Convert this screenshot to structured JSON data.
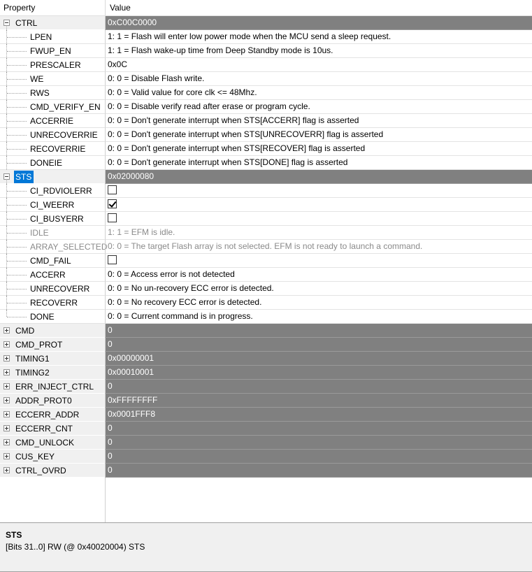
{
  "header": {
    "property": "Property",
    "value": "Value"
  },
  "rows": [
    {
      "name": "CTRL",
      "value": "0xC00C0000",
      "level": "top",
      "expander": "minus",
      "dark": true
    },
    {
      "name": "LPEN",
      "value": "1: 1 = Flash will enter low power mode when the MCU send a sleep request.",
      "level": "child"
    },
    {
      "name": "FWUP_EN",
      "value": "1: 1 = Flash wake-up time from Deep Standby mode is 10us.",
      "level": "child"
    },
    {
      "name": "PRESCALER",
      "value": "0x0C",
      "level": "child"
    },
    {
      "name": "WE",
      "value": "0: 0 = Disable Flash write.",
      "level": "child"
    },
    {
      "name": "RWS",
      "value": "0: 0 = Valid value for core clk <= 48Mhz.",
      "level": "child"
    },
    {
      "name": "CMD_VERIFY_EN",
      "value": "0: 0 = Disable verify read after erase or program cycle.",
      "level": "child"
    },
    {
      "name": "ACCERRIE",
      "value": "0: 0 = Don't generate interrupt when STS[ACCERR] flag is asserted",
      "level": "child"
    },
    {
      "name": "UNRECOVERRIE",
      "value": "0: 0 = Don't generate interrupt when STS[UNRECOVERR] flag is asserted",
      "level": "child"
    },
    {
      "name": "RECOVERRIE",
      "value": "0: 0 = Don't generate interrupt when STS[RECOVER] flag is asserted",
      "level": "child"
    },
    {
      "name": "DONEIE",
      "value": "0: 0 = Don't generate interrupt when STS[DONE] flag is asserted",
      "level": "child"
    },
    {
      "name": "STS",
      "value": "0x02000080",
      "level": "top",
      "expander": "minus",
      "dark": true,
      "selected": true
    },
    {
      "name": "CI_RDVIOLERR",
      "value": "",
      "level": "child",
      "checkbox": "unchecked"
    },
    {
      "name": "CI_WEERR",
      "value": "",
      "level": "child",
      "checkbox": "checked"
    },
    {
      "name": "CI_BUSYERR",
      "value": "",
      "level": "child",
      "checkbox": "unchecked"
    },
    {
      "name": "IDLE",
      "value": "1: 1 = EFM is idle.",
      "level": "child",
      "disabled": true
    },
    {
      "name": "ARRAY_SELECTED",
      "value": "0: 0 = The target Flash array is not selected. EFM is not ready to launch a command.",
      "level": "child",
      "disabled": true
    },
    {
      "name": "CMD_FAIL",
      "value": "",
      "level": "child",
      "checkbox": "unchecked"
    },
    {
      "name": "ACCERR",
      "value": "0: 0 = Access error is not detected",
      "level": "child"
    },
    {
      "name": "UNRECOVERR",
      "value": "0: 0 = No un-recovery ECC error is detected.",
      "level": "child"
    },
    {
      "name": "RECOVERR",
      "value": "0: 0 = No recovery ECC error is detected.",
      "level": "child"
    },
    {
      "name": "DONE",
      "value": "0: 0 = Current command is in progress.",
      "level": "child",
      "last": true
    },
    {
      "name": "CMD",
      "value": "0",
      "level": "top",
      "expander": "plus",
      "dark": true
    },
    {
      "name": "CMD_PROT",
      "value": "0",
      "level": "top",
      "expander": "plus",
      "dark": true
    },
    {
      "name": "TIMING1",
      "value": "0x00000001",
      "level": "top",
      "expander": "plus",
      "dark": true
    },
    {
      "name": "TIMING2",
      "value": "0x00010001",
      "level": "top",
      "expander": "plus",
      "dark": true
    },
    {
      "name": "ERR_INJECT_CTRL",
      "value": "0",
      "level": "top",
      "expander": "plus",
      "dark": true
    },
    {
      "name": "ADDR_PROT0",
      "value": "0xFFFFFFFF",
      "level": "top",
      "expander": "plus",
      "dark": true
    },
    {
      "name": "ECCERR_ADDR",
      "value": "0x0001FFF8",
      "level": "top",
      "expander": "plus",
      "dark": true
    },
    {
      "name": "ECCERR_CNT",
      "value": "0",
      "level": "top",
      "expander": "plus",
      "dark": true
    },
    {
      "name": "CMD_UNLOCK",
      "value": "0",
      "level": "top",
      "expander": "plus",
      "dark": true
    },
    {
      "name": "CUS_KEY",
      "value": "0",
      "level": "top",
      "expander": "plus",
      "dark": true
    },
    {
      "name": "CTRL_OVRD",
      "value": "0",
      "level": "top",
      "expander": "plus",
      "dark": true
    }
  ],
  "description": {
    "title": "STS",
    "text": "[Bits 31..0] RW (@ 0x40020004) STS"
  }
}
